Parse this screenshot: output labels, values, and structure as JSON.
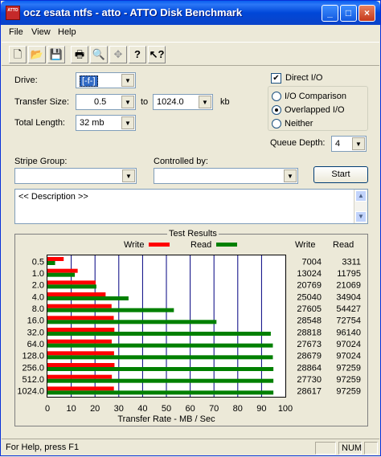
{
  "window": {
    "title": "ocz esata ntfs - atto - ATTO Disk Benchmark",
    "icon_text": "ATTO",
    "min": "_",
    "max": "□",
    "close": "×"
  },
  "menu": [
    "File",
    "View",
    "Help"
  ],
  "toolbar": [
    "new-icon",
    "open-icon",
    "save-icon",
    "print-icon",
    "print-preview-icon",
    "move-icon",
    "help-icon",
    "context-help-icon"
  ],
  "form": {
    "drive_label": "Drive:",
    "drive_value": "[-f-]",
    "transfer_label": "Transfer Size:",
    "transfer_from": "0.5",
    "transfer_to_label": "to",
    "transfer_to": "1024.0",
    "transfer_unit": "kb",
    "length_label": "Total Length:",
    "length_value": "32 mb",
    "direct_io_label": "Direct I/O",
    "direct_io_checked": true,
    "io_comparison_label": "I/O Comparison",
    "overlapped_io_label": "Overlapped I/O",
    "neither_label": "Neither",
    "queue_depth_label": "Queue Depth:",
    "queue_depth_value": "4",
    "stripe_group_label": "Stripe Group:",
    "controlled_by_label": "Controlled by:",
    "start_label": "Start",
    "description": "<< Description >>"
  },
  "results": {
    "title": "Test Results",
    "write_legend": "Write",
    "read_legend": "Read",
    "write_col": "Write",
    "read_col": "Read",
    "write_color": "#ff0000",
    "read_color": "#008000"
  },
  "chart_data": {
    "type": "bar",
    "title": "Test Results",
    "xlabel": "Transfer Rate - MB / Sec",
    "xlim": [
      0,
      100
    ],
    "xticks": [
      "0",
      "10",
      "20",
      "30",
      "40",
      "50",
      "60",
      "70",
      "80",
      "90",
      "100"
    ],
    "categories": [
      "0.5",
      "1.0",
      "2.0",
      "4.0",
      "8.0",
      "16.0",
      "32.0",
      "64.0",
      "128.0",
      "256.0",
      "512.0",
      "1024.0"
    ],
    "series": [
      {
        "name": "Write",
        "values": [
          7004,
          13024,
          20769,
          25040,
          27605,
          28548,
          28818,
          27673,
          28679,
          28864,
          27730,
          28617
        ]
      },
      {
        "name": "Read",
        "values": [
          3311,
          11795,
          21069,
          34904,
          54427,
          72754,
          96140,
          97024,
          97024,
          97259,
          97259,
          97259
        ]
      }
    ]
  },
  "status": {
    "help": "For Help, press F1",
    "num": "NUM"
  }
}
